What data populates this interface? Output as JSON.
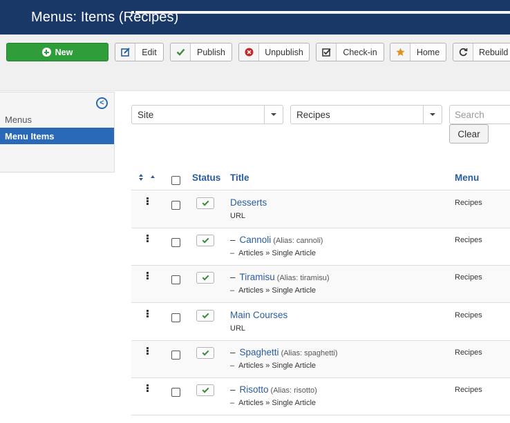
{
  "header": {
    "title": "Menus: Items (Recipes)",
    "menu_icon": "list-icon"
  },
  "toolbar": {
    "new_label": "New",
    "buttons": [
      {
        "label": "Edit",
        "icon": "edit-icon",
        "color": "#2a5d9e"
      },
      {
        "label": "Publish",
        "icon": "check-icon",
        "color": "#3b8a3b"
      },
      {
        "label": "Unpublish",
        "icon": "times-circle-icon",
        "color": "#c52827"
      },
      {
        "label": "Check-in",
        "icon": "checkbox-icon",
        "color": "#333333"
      },
      {
        "label": "Home",
        "icon": "star-icon",
        "color": "#e09220"
      },
      {
        "label": "Rebuild",
        "icon": "refresh-icon",
        "color": "#333333"
      }
    ]
  },
  "sidebar": {
    "items": [
      {
        "label": "Menus",
        "active": false
      },
      {
        "label": "Menu Items",
        "active": true
      }
    ]
  },
  "filters": {
    "site_value": "Site",
    "menu_value": "Recipes",
    "search_placeholder": "Search",
    "clear_label": "Clear"
  },
  "table": {
    "headers": {
      "status": "Status",
      "title": "Title",
      "menu": "Menu"
    },
    "rows": [
      {
        "dash": "",
        "title": "Desserts",
        "alias": "",
        "type": "URL",
        "menu": "Recipes",
        "child": false
      },
      {
        "dash": "–",
        "title": "Cannoli",
        "alias": "(Alias: cannoli)",
        "type": "Articles » Single Article",
        "menu": "Recipes",
        "child": true
      },
      {
        "dash": "–",
        "title": "Tiramisu",
        "alias": "(Alias: tiramisu)",
        "type": "Articles » Single Article",
        "menu": "Recipes",
        "child": true
      },
      {
        "dash": "",
        "title": "Main Courses",
        "alias": "",
        "type": "URL",
        "menu": "Recipes",
        "child": false
      },
      {
        "dash": "–",
        "title": "Spaghetti",
        "alias": "(Alias: spaghetti)",
        "type": "Articles » Single Article",
        "menu": "Recipes",
        "child": true
      },
      {
        "dash": "–",
        "title": "Risotto",
        "alias": "(Alias: risotto)",
        "type": "Articles » Single Article",
        "menu": "Recipes",
        "child": true
      }
    ]
  },
  "colors": {
    "header_bg": "#1a3867",
    "accent": "#2a69b8",
    "new_button": "#2f9d3a"
  }
}
